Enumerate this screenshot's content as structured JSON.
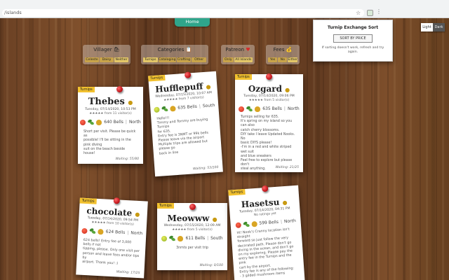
{
  "browser": {
    "url": "/islands"
  },
  "nav": {
    "home": "Home"
  },
  "popup": {
    "title": "Turnip Exchange Sort",
    "button": "SORT BY PRICE",
    "note": "If sorting doesn't work, refresh and try again."
  },
  "theme": {
    "light": "Light",
    "dark": "Dark"
  },
  "filters": [
    {
      "title": "Villager",
      "icon": "dalek-icon",
      "options": [
        "Celeste",
        "Daisy",
        "Neither"
      ],
      "selected": 2
    },
    {
      "title": "Categories",
      "icon": "clipboard-icon",
      "options": [
        "Turnips",
        "Cataloging",
        "Crafting",
        "Other"
      ],
      "selected": 0
    },
    {
      "title": "Patreon",
      "icon": "heart-icon",
      "options": [
        "Only",
        "All Islands"
      ],
      "selected": 1
    },
    {
      "title": "Fees",
      "icon": "money-bag-icon",
      "options": [
        "Yes",
        "No",
        "Either"
      ],
      "selected": 2
    }
  ],
  "cards": [
    {
      "tag": "Turnips",
      "name": "Thebes",
      "date": "Tuesday, 07/14/2020, 10:53 PM",
      "visitors": "from 11 visitor(s)",
      "fruit": "apple",
      "bells": "640 Bells",
      "hemisphere": "North",
      "body": [
        "Short per visit. Please be quick as",
        "possible! I'll be sitting in the pink diving",
        "suit on the beach beside house!"
      ],
      "waiting": "Waiting: 55/80"
    },
    {
      "tag": "Turnips",
      "name": "Hufflepuff",
      "date": "Wednesday, 07/15/2020, 10:07 AM",
      "visitors": "from 7 visitor(s)",
      "fruit": "pear",
      "bells": "635 Bells",
      "hemisphere": "South",
      "body": [
        "Hello!!!",
        "Timmy and Tommy are buying Turnips",
        "for 635.",
        "Entry fee is 3NMT or 99k bells",
        "Please leave via the airport",
        "Multiple trips are allowed but please go",
        "back in line"
      ],
      "waiting": "Waiting: 53/100"
    },
    {
      "tag": "Turnips",
      "name": "Ozgard",
      "date": "Tuesday, 07/14/2020, 09:06 PM",
      "visitors": "from 5 visitor(s)",
      "fruit": "apple",
      "bells": "635 Bells",
      "hemisphere": "North",
      "body": [
        "Turnips selling for 635.",
        "It's spring on my island so you can also",
        "catch cherry blossoms.",
        "DIY take I leave Updated Nooks. No",
        "basic DIYS please!",
        "-I'm in a red and white striped wet suit",
        "and blue sneakers",
        "Feel free to explore but please don't",
        "steal anything."
      ],
      "waiting": "Waiting: 21/25"
    },
    {
      "tag": "Turnips",
      "name": "chocolate",
      "date": "Tuesday, 07/14/2020, 09:54 PM",
      "visitors": "from 10 visitor(s)",
      "fruit": "apple",
      "bells": "624 Bells",
      "hemisphere": "North",
      "body": [
        "624 bells! Entry fee of 3,000 bells if not",
        "tipping, please. Only one visit per",
        "person and leave fees and/or tips by",
        "airport. Thank you! :)"
      ],
      "waiting": "Waiting: 17/25"
    },
    {
      "tag": "Turnips",
      "name": "Meowww",
      "date": "Wednesday, 07/15/2020, 12:09 AM",
      "visitors": "from 5 visitor(s)",
      "fruit": "pear",
      "bells": "611 Bells",
      "hemisphere": "South",
      "body": [
        "3nmts per visit trip"
      ],
      "waiting": "Waiting: 0/100"
    },
    {
      "tag": "Turnips",
      "name": "Hasetsu",
      "date": "Tuesday, 07/14/2020, 04:31 PM",
      "visitors": "No ratings yet",
      "fruit": "apple",
      "bells": "599 Bells",
      "hemisphere": "North",
      "body": [
        "Hi! Nook's Cranny location isn't straight",
        "forward so just follow the very",
        "decorated path. Please don't go",
        "diving in the ocean, and don't go",
        "on my exploring. Please pay the",
        "entry fee in the Turnips and the pink",
        "cart by the airport.",
        "",
        "Entry fee is any of the following:",
        "- 3 gilded mushroom items"
      ],
      "waiting": ""
    }
  ]
}
